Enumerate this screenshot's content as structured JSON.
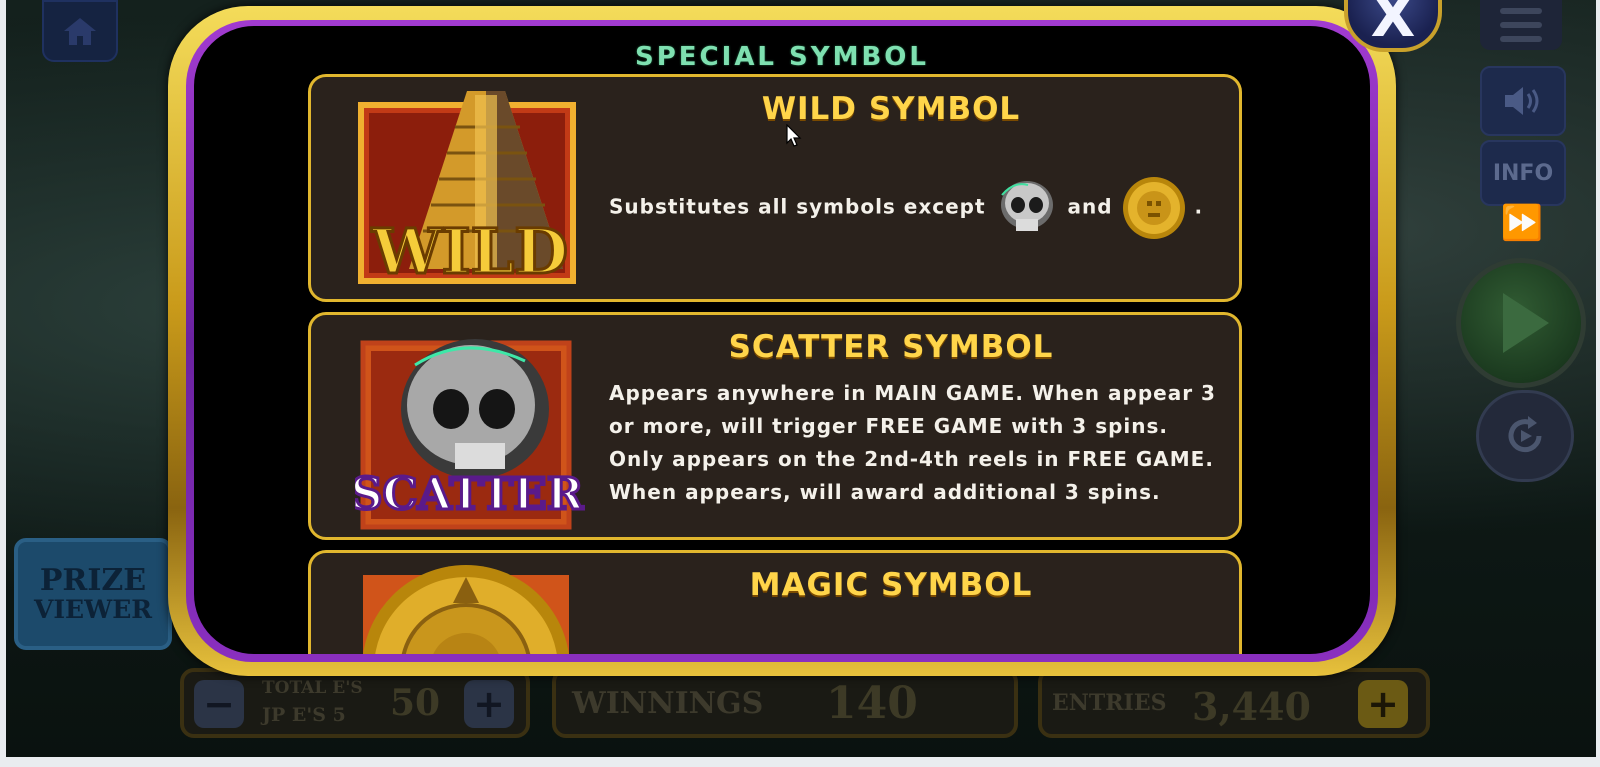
{
  "game": {
    "prize_viewer": {
      "line1": "PRIZE",
      "line2": "VIEWER"
    },
    "right_controls": {
      "info_label": "INFO"
    },
    "bottom_bar": {
      "total_label_1": "TOTAL E'S",
      "total_label_2": "JP E'S 5",
      "total_value": "50",
      "winnings_label": "WINNINGS",
      "winnings_value": "140",
      "entries_label": "ENTRIES",
      "entries_value": "3,440",
      "minus_label": "−",
      "plus_label": "+"
    }
  },
  "modal": {
    "heading": "SPECIAL SYMBOL",
    "close_label": "X",
    "cards": [
      {
        "title": "WILD SYMBOL",
        "text_before": "Substitutes all symbols except",
        "text_and": "and",
        "text_end": ".",
        "symbol_word": "WILD"
      },
      {
        "title": "SCATTER SYMBOL",
        "lines": [
          "Appears anywhere in MAIN GAME. When appear 3",
          "or more, will trigger FREE GAME with 3 spins.",
          "Only appears on the 2nd-4th reels in FREE GAME.",
          "When appears, will award additional 3 spins."
        ],
        "symbol_word": "SCATTER"
      },
      {
        "title": "MAGIC SYMBOL"
      }
    ]
  },
  "colors": {
    "modal_gold": "#e1b72e",
    "modal_purple": "#8a2fbf",
    "heading_green": "#7ee0b0",
    "title_gold": "#ffd54a",
    "card_bg": "#2a221c"
  },
  "icons": [
    "home-icon",
    "menu-icon",
    "speaker-icon",
    "fast-forward-icon",
    "play-icon",
    "autoplay-icon",
    "close-icon",
    "wild-pyramid-icon",
    "scatter-skull-icon",
    "magic-coin-icon",
    "skull-icon",
    "gold-coin-icon",
    "cursor-icon"
  ]
}
